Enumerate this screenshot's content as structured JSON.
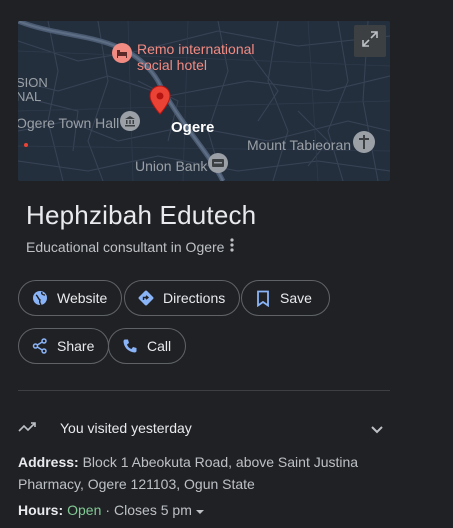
{
  "map": {
    "labels": {
      "hotel": "Remo international\nsocial hotel",
      "hotel_line1": "Remo international",
      "hotel_line2": "social hotel",
      "sion": "SION",
      "nal": "NAL",
      "town_hall": "Ogere Town Hall",
      "town": "Ogere",
      "mount": "Mount Tabieoran",
      "bank": "Union Bank"
    },
    "icons": {
      "expand": "expand-icon",
      "pin": "location-pin-icon",
      "hotel": "bed-icon",
      "town_hall": "museum-icon",
      "mount": "cross-icon",
      "bank": "bank-icon"
    }
  },
  "place": {
    "name": "Hephzibah Edutech",
    "category": "Educational consultant in Ogere",
    "more_icon": "more-vert-icon"
  },
  "actions": {
    "website": "Website",
    "directions": "Directions",
    "save": "Save",
    "share": "Share",
    "call": "Call"
  },
  "visited": {
    "text": "You visited yesterday",
    "icon": "trend-icon"
  },
  "address": {
    "label": "Address:",
    "value": "Block 1 Abeokuta Road, above Saint Justina Pharmacy, Ogere 121103, Ogun State"
  },
  "hours": {
    "label": "Hours:",
    "status": "Open",
    "separator": "·",
    "closes": "Closes 5 pm"
  },
  "colors": {
    "background": "#202124",
    "map_bg": "#242f3e",
    "accent_blue": "#8ab4f8",
    "open_green": "#81c995",
    "pin_red": "#ea4335",
    "poi_pink": "#f28b82"
  }
}
